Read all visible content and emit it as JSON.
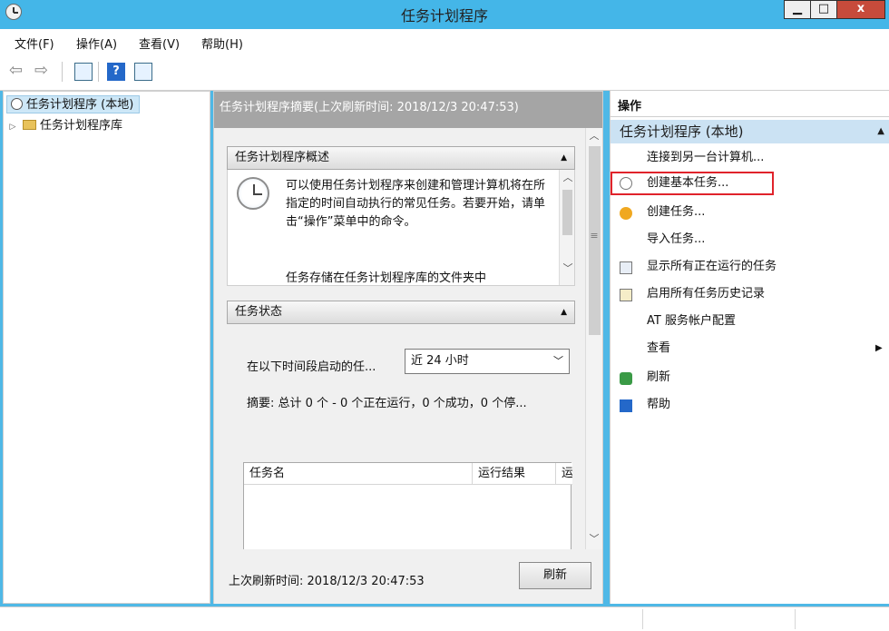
{
  "window": {
    "title": "任务计划程序",
    "min_glyph": "▁",
    "max_glyph": "□",
    "close_glyph": "x"
  },
  "menu": [
    "文件(F)",
    "操作(A)",
    "查看(V)",
    "帮助(H)"
  ],
  "toolbar": {
    "back_glyph": "⇦",
    "forward_glyph": "⇨",
    "help_glyph": "?"
  },
  "tree": {
    "root": "任务计划程序 (本地)",
    "library": "任务计划程序库",
    "expand_glyph": "▷"
  },
  "middle": {
    "header": "任务计划程序摘要(上次刷新时间: 2018/12/3 20:47:53)",
    "overview": {
      "title": "任务计划程序概述",
      "text": "可以使用任务计划程序来创建和管理计算机将在所指定的时间自动执行的常见任务。若要开始，请单击“操作”菜单中的命令。",
      "text2": "任务存储在任务计划程序库的文件夹中"
    },
    "status": {
      "title": "任务状态",
      "period_label": "在以下时间段启动的任...",
      "period_value": "近 24 小时",
      "summary": "摘要: 总计 0 个 - 0 个正在运行，0 个成功，0 个停...",
      "columns": [
        "任务名",
        "运行结果",
        "运"
      ]
    },
    "footer": {
      "refresh_time": "上次刷新时间: 2018/12/3 20:47:53",
      "refresh_button": "刷新"
    },
    "collapse_glyph": "▲",
    "scroll_up": "︿",
    "scroll_down": "﹀",
    "grip": "≡"
  },
  "actions": {
    "title": "操作",
    "group": "任务计划程序 (本地)",
    "items": [
      "连接到另一台计算机...",
      "创建基本任务...",
      "创建任务...",
      "导入任务...",
      "显示所有正在运行的任务",
      "启用所有任务历史记录",
      "AT 服务帐户配置",
      "查看",
      "刷新",
      "帮助"
    ],
    "submenu_glyph": "▶",
    "highlighted_index": 1
  },
  "colors": {
    "titlebar": "#44b6e8",
    "selection": "#cbe2f3",
    "highlight": "#e0232b"
  }
}
